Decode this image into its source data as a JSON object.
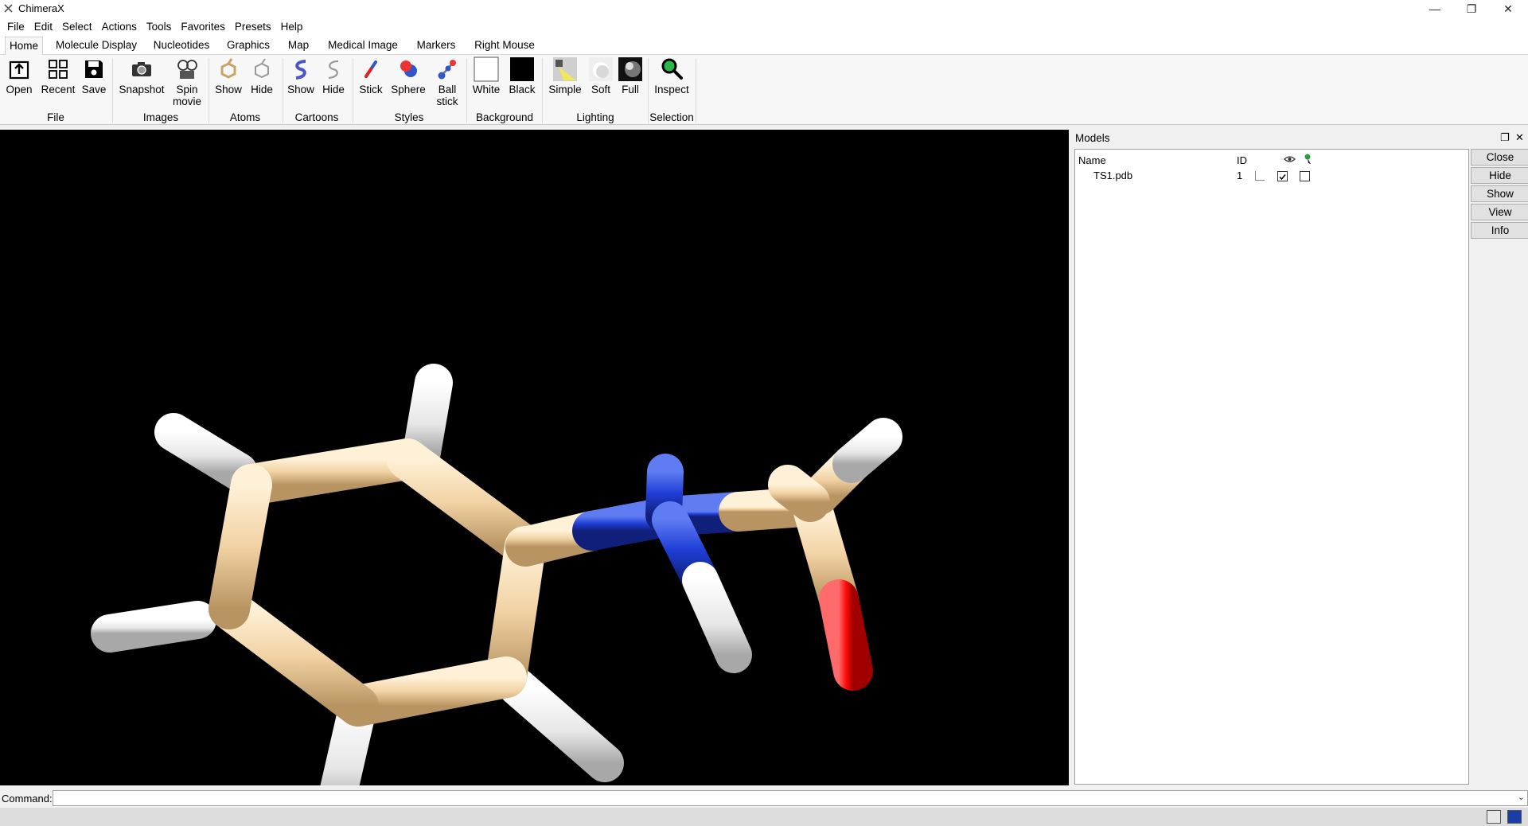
{
  "window": {
    "title": "ChimeraX",
    "minimize_glyph": "—",
    "restore_glyph": "❐",
    "close_glyph": "✕"
  },
  "menu": [
    "File",
    "Edit",
    "Select",
    "Actions",
    "Tools",
    "Favorites",
    "Presets",
    "Help"
  ],
  "tabs": [
    "Home",
    "Molecule Display",
    "Nucleotides",
    "Graphics",
    "Map",
    "Medical Image",
    "Markers",
    "Right Mouse"
  ],
  "active_tab": "Home",
  "ribbon": {
    "file": {
      "label": "File",
      "open": "Open",
      "recent": "Recent",
      "save": "Save"
    },
    "images": {
      "label": "Images",
      "snapshot": "Snapshot",
      "spin1": "Spin",
      "spin2": "movie"
    },
    "atoms": {
      "label": "Atoms",
      "show": "Show",
      "hide": "Hide"
    },
    "cartoons": {
      "label": "Cartoons",
      "show": "Show",
      "hide": "Hide"
    },
    "styles": {
      "label": "Styles",
      "stick": "Stick",
      "sphere": "Sphere",
      "ball1": "Ball",
      "ball2": "stick"
    },
    "background": {
      "label": "Background",
      "white": "White",
      "black": "Black"
    },
    "lighting": {
      "label": "Lighting",
      "simple": "Simple",
      "soft": "Soft",
      "full": "Full"
    },
    "selection": {
      "label": "Selection",
      "inspect": "Inspect"
    }
  },
  "models": {
    "title": "Models",
    "float_glyph": "❐",
    "close_glyph": "✕",
    "columns": {
      "name": "Name",
      "id": "ID"
    },
    "rows": [
      {
        "name": "TS1.pdb",
        "id": "1",
        "shown": true,
        "selected": false
      }
    ],
    "buttons": [
      "Close",
      "Hide",
      "Show",
      "View",
      "Info"
    ]
  },
  "command": {
    "label": "Command:",
    "value": "",
    "dropdown_glyph": "⌄"
  },
  "colors": {
    "carbon": "#f2d2a4",
    "nitrogen": "#1f3ed6",
    "oxygen": "#ff0d0d",
    "hydrogen": "#ffffff",
    "viewport_bg": "#000000"
  },
  "icons": [
    "app-icon",
    "open-icon",
    "recent-icon",
    "save-icon",
    "camera-icon",
    "film-icon",
    "atoms-show-icon",
    "atoms-hide-icon",
    "cartoon-show-icon",
    "cartoon-hide-icon",
    "stick-icon",
    "sphere-icon",
    "ball-stick-icon",
    "white-swatch-icon",
    "black-swatch-icon",
    "simple-light-icon",
    "soft-light-icon",
    "full-light-icon",
    "magnifier-icon",
    "eye-icon",
    "select-icon"
  ]
}
